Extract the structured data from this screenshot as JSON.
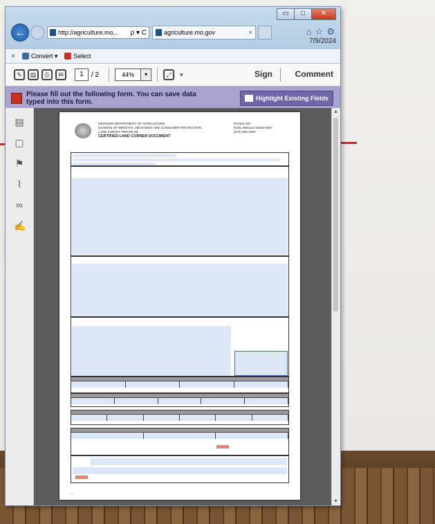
{
  "browser": {
    "address_url": "http://agriculture.mo...",
    "address_controls": "ρ ▾ C",
    "tab_title": "agriculture.mo.gov",
    "tab_close": "×",
    "window_buttons": [
      "▭",
      "□",
      "✕"
    ],
    "toolbar_icons": [
      "⌂",
      "☆",
      "⚙"
    ]
  },
  "date_stamp": "7/9/2024",
  "command_bar": {
    "close": "×",
    "convert_label": "Convert ▾",
    "select_label": "Select"
  },
  "pdf_toolbar": {
    "current_page": "1",
    "total_pages": "/ 2",
    "zoom": "44%",
    "zoom_caret": "▾",
    "sign_label": "Sign",
    "comment_label": "Comment"
  },
  "form_notice": {
    "message": "Please fill out the following form. You can save data typed into this form.",
    "highlight_button": "Highlight Existing Fields"
  },
  "rail_icons": [
    "page-icon",
    "pages-icon",
    "bookmark-icon",
    "attachment-icon",
    "binoculars-icon",
    "signature-icon"
  ],
  "document": {
    "header_left": [
      "MISSOURI DEPARTMENT OF AGRICULTURE",
      "DIVISION OF WEIGHTS, MEASURES AND CONSUMER PROTECTION",
      "LAND SURVEY PROGRAM"
    ],
    "header_title": "CERTIFIED LAND CORNER DOCUMENT",
    "header_right": [
      "PO Box 937",
      "Rolla, Missouri 65402-0937",
      "(573) 368-2300"
    ]
  }
}
